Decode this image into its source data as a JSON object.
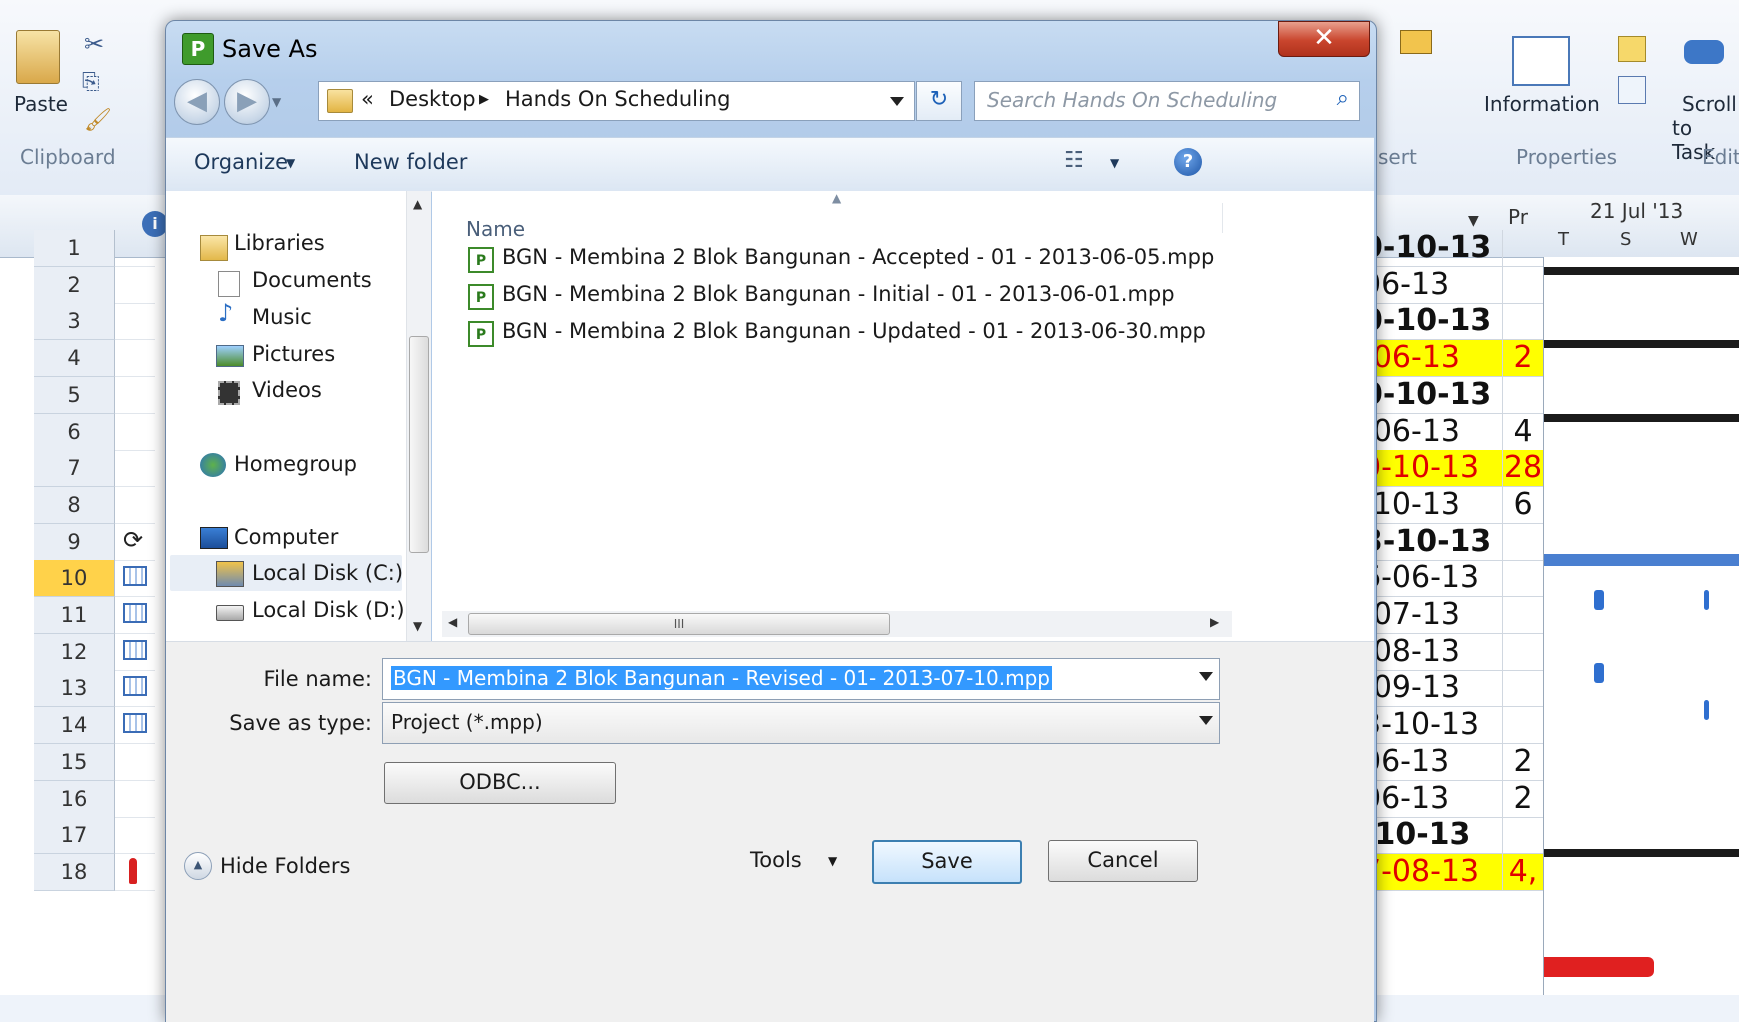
{
  "app": {
    "ribbon": {
      "paste_label": "Paste",
      "clipboard_group": "Clipboard",
      "insert_group_partial": "sert",
      "information_label": "Information",
      "properties_group": "Properties",
      "scroll_label": "Scroll",
      "to_task_label": "to Task",
      "editing_group_partial": "Edit"
    },
    "grid": {
      "pr_header": "Pr",
      "timescale_week": "21 Jul '13",
      "timescale_days": [
        "T",
        "S",
        "W"
      ],
      "rows": [
        {
          "num": "1",
          "date": "0-10-13",
          "pr": "",
          "bold": true,
          "hl": false,
          "red": false
        },
        {
          "num": "2",
          "date": "06-13",
          "pr": "",
          "bold": false,
          "hl": false,
          "red": false
        },
        {
          "num": "3",
          "date": "0-10-13",
          "pr": "",
          "bold": true,
          "hl": false,
          "red": false
        },
        {
          "num": "4",
          "date": "-06-13",
          "pr": "2",
          "bold": false,
          "hl": true,
          "red": true
        },
        {
          "num": "5",
          "date": "0-10-13",
          "pr": "",
          "bold": true,
          "hl": false,
          "red": false
        },
        {
          "num": "6",
          "date": "-06-13",
          "pr": "4",
          "bold": false,
          "hl": false,
          "red": false
        },
        {
          "num": "7",
          "date": "0-10-13",
          "pr": "28",
          "bold": false,
          "hl": true,
          "red": true
        },
        {
          "num": "8",
          "date": "-10-13",
          "pr": "6",
          "bold": false,
          "hl": false,
          "red": false
        },
        {
          "num": "9",
          "date": "3-10-13",
          "pr": "",
          "bold": true,
          "hl": false,
          "red": false
        },
        {
          "num": "10",
          "date": "6-06-13",
          "pr": "",
          "bold": false,
          "hl": false,
          "red": false
        },
        {
          "num": "11",
          "date": "-07-13",
          "pr": "",
          "bold": false,
          "hl": false,
          "red": false
        },
        {
          "num": "12",
          "date": "-08-13",
          "pr": "",
          "bold": false,
          "hl": false,
          "red": false
        },
        {
          "num": "13",
          "date": "-09-13",
          "pr": "",
          "bold": false,
          "hl": false,
          "red": false
        },
        {
          "num": "14",
          "date": "3-10-13",
          "pr": "",
          "bold": false,
          "hl": false,
          "red": false
        },
        {
          "num": "15",
          "date": "06-13",
          "pr": "2",
          "bold": false,
          "hl": false,
          "red": false
        },
        {
          "num": "16",
          "date": "06-13",
          "pr": "2",
          "bold": false,
          "hl": false,
          "red": false
        },
        {
          "num": "17",
          "date": "-10-13",
          "pr": "",
          "bold": true,
          "hl": false,
          "red": false
        },
        {
          "num": "18",
          "date": "7-08-13",
          "pr": "4,",
          "bold": false,
          "hl": true,
          "red": true
        }
      ]
    }
  },
  "dialog": {
    "title": "Save As",
    "close_glyph": "✕",
    "address": {
      "prefix": "«",
      "crumbs": [
        "Desktop",
        "Hands On Scheduling"
      ]
    },
    "search_placeholder": "Search Hands On Scheduling",
    "toolbar": {
      "organize": "Organize",
      "new_folder": "New folder"
    },
    "nav": {
      "libraries": "Libraries",
      "documents": "Documents",
      "music": "Music",
      "pictures": "Pictures",
      "videos": "Videos",
      "homegroup": "Homegroup",
      "computer": "Computer",
      "local_c": "Local Disk (C:)",
      "local_d": "Local Disk (D:)"
    },
    "file_list": {
      "column_name": "Name",
      "files": [
        "BGN - Membina 2 Blok Bangunan - Accepted - 01 - 2013-06-05.mpp",
        "BGN - Membina 2 Blok Bangunan - Initial - 01 - 2013-06-01.mpp",
        "BGN - Membina 2 Blok Bangunan - Updated - 01 - 2013-06-30.mpp"
      ],
      "hscroll_grip": "III"
    },
    "form": {
      "file_name_label": "File name:",
      "file_name_value": "BGN - Membina 2 Blok Bangunan - Revised - 01- 2013-07-10.mpp",
      "save_type_label": "Save as type:",
      "save_type_value": "Project (*.mpp)",
      "odbc_button": "ODBC..."
    },
    "footer": {
      "hide_folders": "Hide Folders",
      "tools": "Tools",
      "save": "Save",
      "cancel": "Cancel"
    }
  }
}
